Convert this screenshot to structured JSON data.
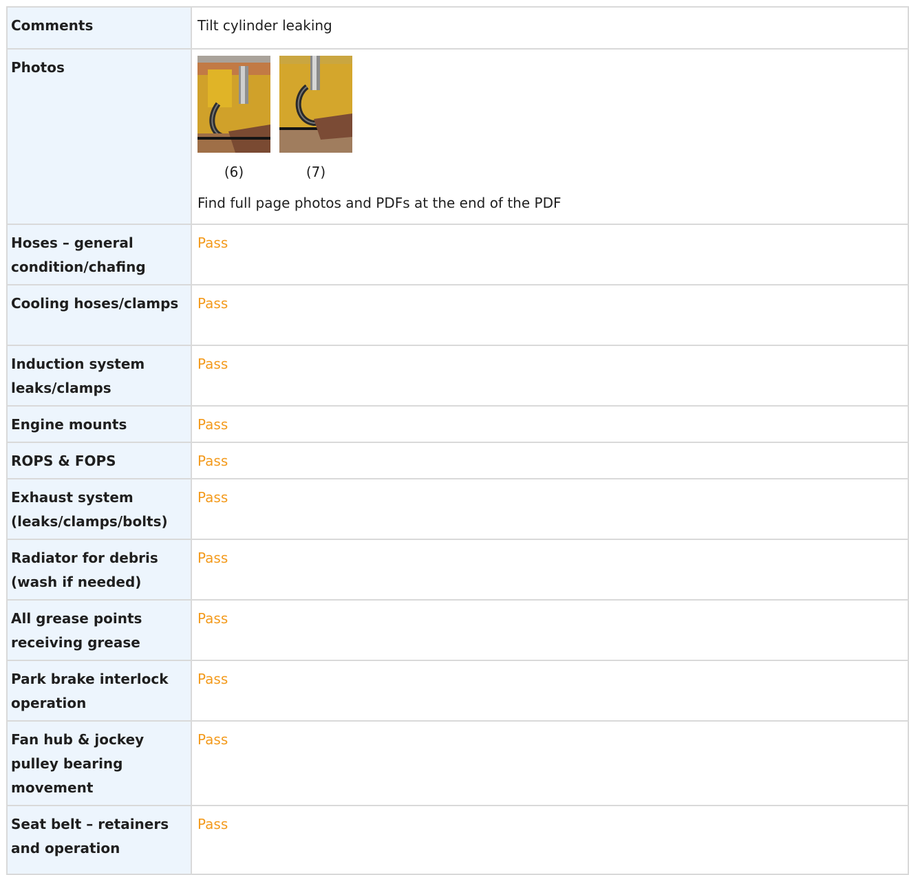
{
  "rows": [
    {
      "label": "Comments",
      "value": "Tilt cylinder leaking",
      "status": false
    },
    {
      "label": "Photos"
    },
    {
      "label": "Hoses – general condition/chafing",
      "value": "Pass",
      "status": true
    },
    {
      "label": "Cooling hoses/clamps",
      "value": "Pass",
      "status": true
    },
    {
      "label": "Induction system leaks/clamps",
      "value": "Pass",
      "status": true
    },
    {
      "label": "Engine mounts",
      "value": "Pass",
      "status": true
    },
    {
      "label": "ROPS & FOPS",
      "value": "Pass",
      "status": true
    },
    {
      "label": "Exhaust system (leaks/clamps/bolts)",
      "value": "Pass",
      "status": true
    },
    {
      "label": "Radiator for debris (wash if needed)",
      "value": "Pass",
      "status": true
    },
    {
      "label": "All grease points receiving grease",
      "value": "Pass",
      "status": true
    },
    {
      "label": "Park brake interlock operation",
      "value": "Pass",
      "status": true
    },
    {
      "label": "Fan hub & jockey pulley bearing movement",
      "value": "Pass",
      "status": true
    },
    {
      "label": "Seat belt – retainers and operation",
      "value": "Pass",
      "status": true
    }
  ],
  "photos": {
    "items": [
      {
        "caption": "(6)",
        "alt": "tilt cylinder hose photo 6"
      },
      {
        "caption": "(7)",
        "alt": "tilt cylinder hose photo 7"
      }
    ],
    "note": "Find full page photos and PDFs at the end of the PDF"
  },
  "colors": {
    "label_background": "#edf5fd",
    "border": "#d9d9d9",
    "pass": "#f39a1c",
    "text": "#1f1f1f"
  }
}
